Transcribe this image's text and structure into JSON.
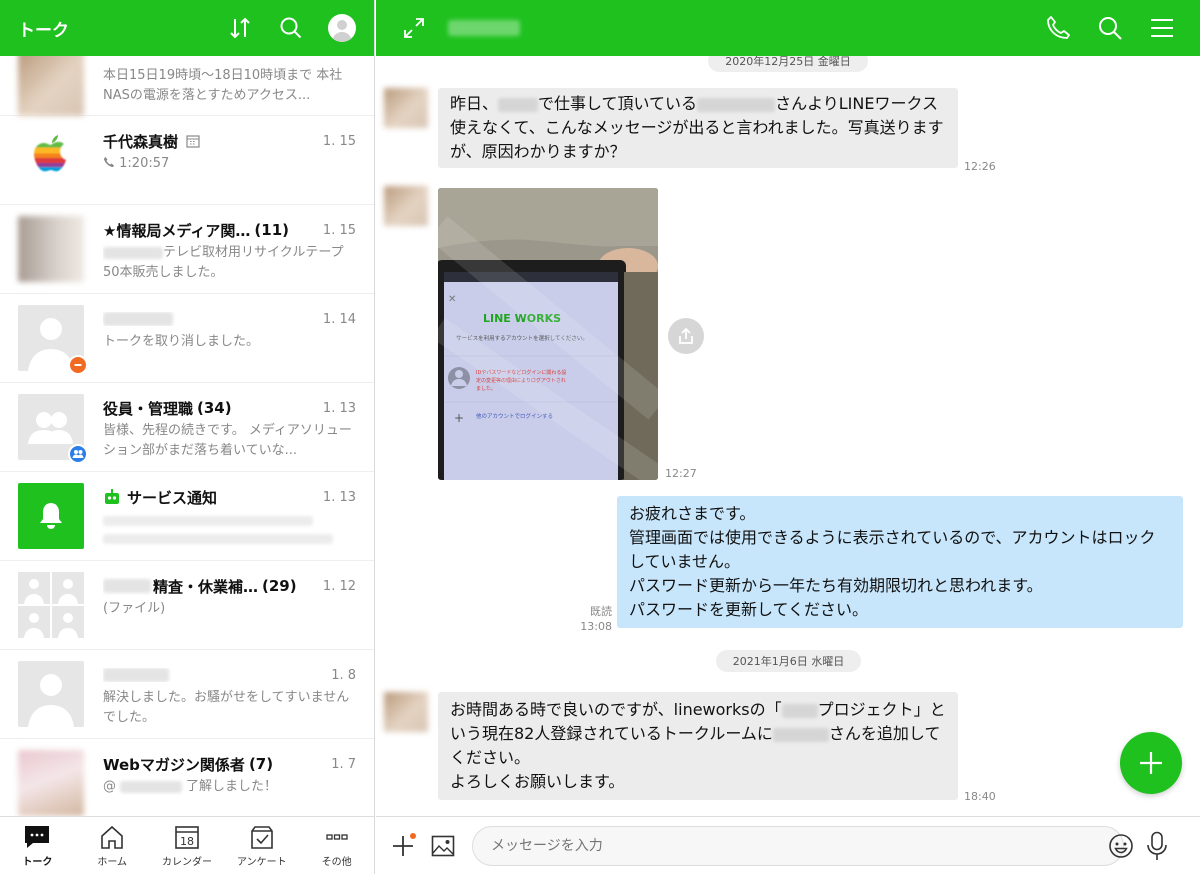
{
  "left_header": {
    "title": "トーク"
  },
  "talks": [
    {
      "name": "",
      "count": "",
      "date": "",
      "message": "本日15日19時頃〜18日10時頃まで 本社NASの電源を落とすためアクセス...",
      "avatar": "photo"
    },
    {
      "name": "千代森真樹",
      "count": "",
      "date": "1. 15",
      "message": "1:20:57",
      "avatar": "apple"
    },
    {
      "name": "★情報局メディア関…",
      "count": "(11)",
      "date": "1. 15",
      "message": "テレビ取材用リサイクルテープ50本販売しました。",
      "avatar": "photo"
    },
    {
      "name": "",
      "count": "",
      "date": "1. 14",
      "message": "トークを取り消しました。",
      "avatar": "person-blocked"
    },
    {
      "name": "役員・管理職",
      "count": "(34)",
      "date": "1. 13",
      "message": "皆様、先程の続きです。 メディアソリューション部がまだ落ち着いていな...",
      "avatar": "group"
    },
    {
      "name": "サービス通知",
      "count": "",
      "date": "1. 13",
      "message": "",
      "avatar": "bell"
    },
    {
      "name": "精査・休業補…",
      "count": "(29)",
      "date": "1. 12",
      "message": "(ファイル)",
      "avatar": "grid"
    },
    {
      "name": "",
      "count": "",
      "date": "1. 8",
      "message": "解決しました。お騒がせをしてすいませんでした。",
      "avatar": "person"
    },
    {
      "name": "Webマガジン関係者",
      "count": "(7)",
      "date": "1. 7",
      "message": "了解しました！",
      "avatar": "photo-pink"
    }
  ],
  "bottom_nav": [
    {
      "label": "トーク",
      "icon": "chat-icon",
      "active": true
    },
    {
      "label": "ホーム",
      "icon": "home-icon",
      "active": false
    },
    {
      "label": "カレンダー",
      "icon": "calendar-icon",
      "active": false,
      "day": "18"
    },
    {
      "label": "アンケート",
      "icon": "survey-icon",
      "active": false
    },
    {
      "label": "その他",
      "icon": "more-icon",
      "active": false
    }
  ],
  "chat": {
    "date1": "2020年12月25日 金曜日",
    "msg1": {
      "part_a": "昨日、",
      "part_b": "で仕事して頂いている",
      "part_c": "さんよりLINEワークス使えなくて、こんなメッセージが出ると言われました。写真送りますが、原因わかりますか？",
      "time": "12:26"
    },
    "photo": {
      "logo": "LINE WORKS",
      "line1": "サービスを利用するアカウントを選択してください。",
      "warn": "IDやパスワードなどログインに関わる設定の変更等の理由によりログアウトされました。",
      "other": "他のアカウントでログインする",
      "time": "12:27"
    },
    "msg2": {
      "lines": [
        "お疲れさまです。",
        "管理画面では使用できるように表示されているので、アカウントはロックしていません。",
        "パスワード更新から一年たち有効期限切れと思われます。",
        "パスワードを更新してください。"
      ],
      "read": "既読",
      "time": "13:08"
    },
    "date2": "2021年1月6日 水曜日",
    "msg3": {
      "part_a": "お時間ある時で良いのですが、lineworksの「",
      "part_b": "プロジェクト」という現在82人登録されているトークルームに",
      "part_c": "さんを追加してください。",
      "part_d": "よろしくお願いします。",
      "time": "18:40"
    }
  },
  "input": {
    "placeholder": "メッセージを入力"
  },
  "colors": {
    "brand": "#1fc11f",
    "incoming": "#ececec",
    "outgoing": "#c7e6fb",
    "badge_orange": "#f26a21",
    "badge_blue": "#2b7de9"
  }
}
